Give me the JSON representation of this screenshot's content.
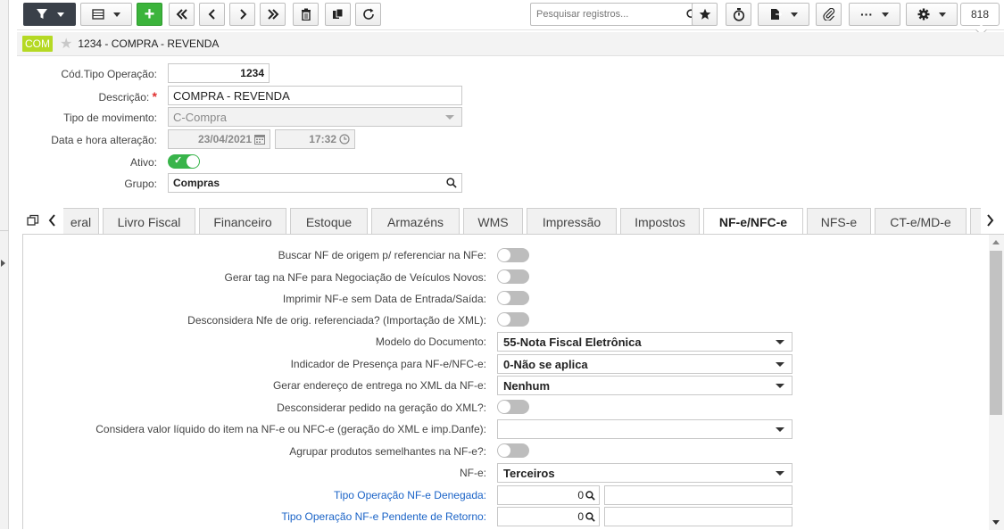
{
  "toolbar": {
    "search_placeholder": "Pesquisar registros...",
    "record_count": "818"
  },
  "header": {
    "module_badge": "COM",
    "record_title": "1234 - COMPRA - REVENDA"
  },
  "form": {
    "cod_label": "Cód.Tipo Operação:",
    "cod_value": "1234",
    "desc_label": "Descrição:",
    "desc_value": "COMPRA - REVENDA",
    "tipo_label": "Tipo de movimento:",
    "tipo_value": "C-Compra",
    "data_label": "Data e hora alteração:",
    "data_value": "23/04/2021",
    "hora_value": "17:32",
    "ativo_label": "Ativo:",
    "ativo_value": true,
    "grupo_label": "Grupo:",
    "grupo_value": "Compras"
  },
  "tabs": [
    {
      "label": "eral"
    },
    {
      "label": "Livro Fiscal"
    },
    {
      "label": "Financeiro"
    },
    {
      "label": "Estoque"
    },
    {
      "label": "Armazéns"
    },
    {
      "label": "WMS"
    },
    {
      "label": "Impressão"
    },
    {
      "label": "Impostos"
    },
    {
      "label": "NF-e/NFC-e",
      "active": true
    },
    {
      "label": "NFS-e"
    },
    {
      "label": "CT-e/MD-e"
    }
  ],
  "nfe": {
    "buscar_nf": "Buscar NF de origem p/ referenciar na NFe:",
    "gerar_tag": "Gerar tag na NFe para Negociação de Veículos Novos:",
    "imprimir": "Imprimir NF-e sem Data de Entrada/Saída:",
    "desconsidera": "Desconsidera Nfe de orig. referenciada? (Importação de XML):",
    "modelo_label": "Modelo do Documento:",
    "modelo_value": "55-Nota Fiscal Eletrônica",
    "indicador_label": "Indicador de Presença para NF-e/NFC-e:",
    "indicador_value": "0-Não se aplica",
    "endereco_label": "Gerar endereço de entrega no XML da NF-e:",
    "endereco_value": "Nenhum",
    "desconsiderar_pedido": "Desconsiderar pedido na geração do XML?:",
    "valor_liquido_label": "Considera valor líquido do item na NF-e ou NFC-e (geração do XML e imp.Danfe):",
    "valor_liquido_value": "",
    "agrupar": "Agrupar produtos semelhantes na NF-e?:",
    "nfe_label": "NF-e:",
    "nfe_value": "Terceiros",
    "denegada_label": "Tipo Operação NF-e Denegada:",
    "denegada_value": "0",
    "pendente_label": "Tipo Operação NF-e Pendente de Retorno:",
    "pendente_value": "0"
  },
  "colors": {
    "badge": "#b5d924",
    "toggle_on": "#38b44a",
    "link": "#1a63c7",
    "dark_button": "#3a4049",
    "add_button": "#3cb43c"
  }
}
